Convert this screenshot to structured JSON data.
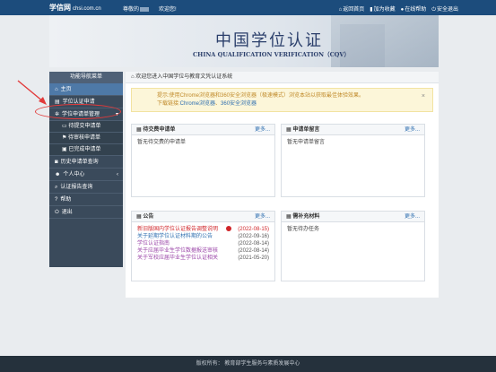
{
  "header": {
    "logo": "学信网",
    "logo_domain": "chsi.com.cn",
    "greeting_prefix": "尊敬的",
    "greeting_suffix": "欢迎您!",
    "links": [
      {
        "label": "返回首页",
        "icon": "home-icon"
      },
      {
        "label": "加为收藏",
        "icon": "bookmark-icon"
      },
      {
        "label": "在线帮助",
        "icon": "help-icon"
      },
      {
        "label": "安全退出",
        "icon": "power-icon"
      }
    ]
  },
  "banner": {
    "title": "中国学位认证",
    "subtitle": "CHINA QUALIFICATION VERIFICATION（CQV）"
  },
  "sidebar": {
    "header": "功能导航菜单",
    "items": [
      {
        "label": "主页",
        "icon": "home-icon"
      },
      {
        "label": "学位认证申请",
        "icon": "file-icon"
      },
      {
        "label": "学位申请单管理",
        "icon": "gear-icon"
      },
      {
        "label": "待提交申请单",
        "icon": "inbox-icon"
      },
      {
        "label": "待审核申请单",
        "icon": "flag-icon"
      },
      {
        "label": "已完成申请单",
        "icon": "briefcase-icon"
      },
      {
        "label": "历史申请单查询",
        "icon": "camera-icon"
      },
      {
        "label": "个人中心",
        "icon": "user-icon"
      },
      {
        "label": "认证报告查询",
        "icon": "search-icon"
      },
      {
        "label": "帮助",
        "icon": "help-icon"
      },
      {
        "label": "退出",
        "icon": "power-icon"
      }
    ]
  },
  "main": {
    "breadcrumb": "欢迎您进入中国学位与教育文凭认证系统",
    "notice": {
      "tip_label": "提示:",
      "tip_text": "使用Chrome浏览器和360安全浏览器（极速模式）浏览本站以获取最佳体验效果。",
      "download_label": "下载链接:",
      "download_links": [
        "Chrome浏览器",
        "360安全浏览器"
      ],
      "separator": "、"
    },
    "panels": {
      "pending": {
        "title": "待交费申请单",
        "more": "更多...",
        "body": "暂无待交费的申请单"
      },
      "messages": {
        "title": "申请单留言",
        "more": "更多...",
        "body": "暂无申请单留言"
      },
      "announcements": {
        "title": "公告",
        "more": "更多...",
        "items": [
          {
            "title": "新旧版国内学位认证报告调整说明",
            "date": "(2022-08-15)",
            "new": true
          },
          {
            "title": "关于延期学位认证材料期的公告",
            "date": "(2022-09-16)"
          },
          {
            "title": "学位认证指南",
            "date": "(2022-08-14)"
          },
          {
            "title": "关于应届毕业生学位数据报送审核",
            "date": "(2022-08-14)"
          },
          {
            "title": "关于军校应届毕业生学位认证相关",
            "date": "(2021-05-20)"
          }
        ]
      },
      "supplement": {
        "title": "需补充材料",
        "more": "更多...",
        "body": "暂无待办任务"
      }
    }
  },
  "footer": {
    "text": "版权所有：  教育部学生服务与素质发展中心"
  }
}
